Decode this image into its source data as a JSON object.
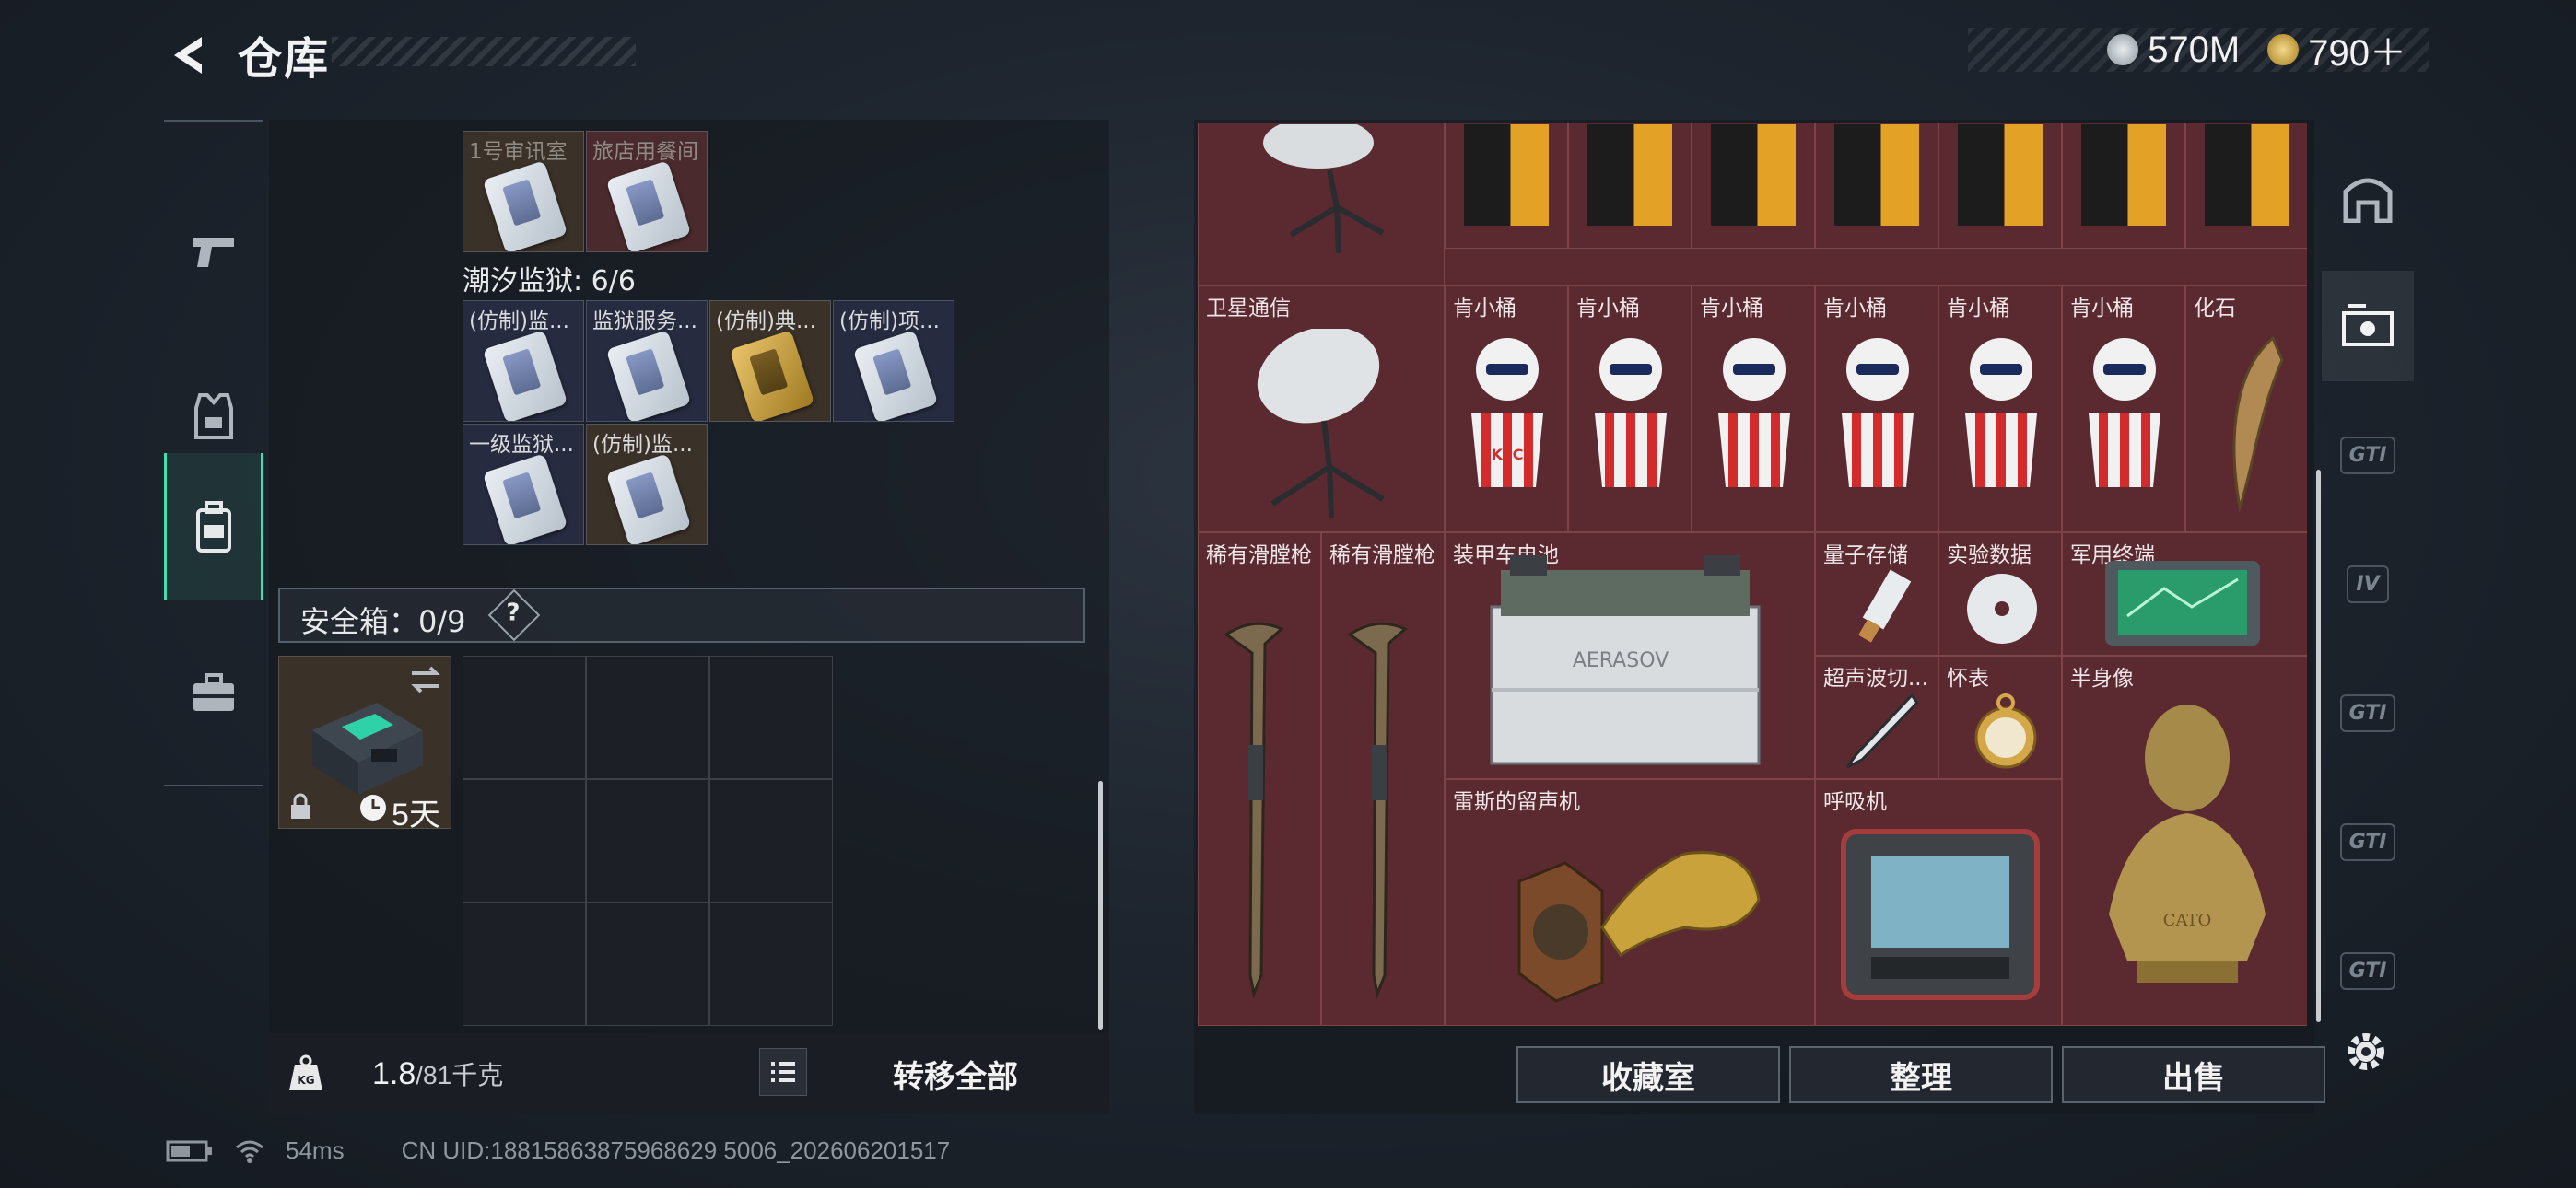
{
  "header": {
    "title": "仓库",
    "silver": "570M",
    "gold": "790＋"
  },
  "left": {
    "room_labels": [
      "1号审讯室",
      "旅店用餐间"
    ],
    "prison_label": "潮汐监狱: 6/6",
    "keys": [
      "(仿制)监...",
      "监狱服务...",
      "(仿制)典...",
      "(仿制)项...",
      "一级监狱...",
      "(仿制)监..."
    ],
    "safe_label": "安全箱：0/9",
    "help": "?",
    "safebox_timer": "5天",
    "weight": "1.8",
    "weight_cap": "/81千克",
    "transfer_all": "转移全部"
  },
  "right": {
    "labels": {
      "sat": "卫星通信",
      "kfc": "肯小桶",
      "fossil": "化石",
      "gun": "稀有滑膛枪",
      "battery": "装甲车电池",
      "quantum": "量子存储",
      "data": "实验数据",
      "terminal": "军用终端",
      "ultrasonic": "超声波切...",
      "watch": "怀表",
      "bust": "半身像",
      "phono": "雷斯的留声机",
      "breath": "呼吸机"
    },
    "battery_text": "AERASOV",
    "bust_text": "CATO",
    "kfc_text": "KFC",
    "buttons": {
      "collection": "收藏室",
      "organize": "整理",
      "sell": "出售"
    }
  },
  "side_rail": {
    "gt1": "GTI",
    "gt2": "IV",
    "gt3": "GTI",
    "gt4": "GTI",
    "gt5": "GTI"
  },
  "status": {
    "ping": "54ms",
    "uid": "CN UID:18815863875968629 5006_202606201517"
  },
  "colors": {
    "accent": "#3fe0b0",
    "grid_bg": "#5a2a30"
  },
  "icons": [
    "back-arrow-icon",
    "pistol-icon",
    "vest-icon",
    "backpack-icon",
    "toolbox-icon",
    "swap-icon",
    "lock-icon",
    "clock-icon",
    "weight-icon",
    "list-icon",
    "gear-icon",
    "wifi-icon",
    "battery-icon"
  ]
}
